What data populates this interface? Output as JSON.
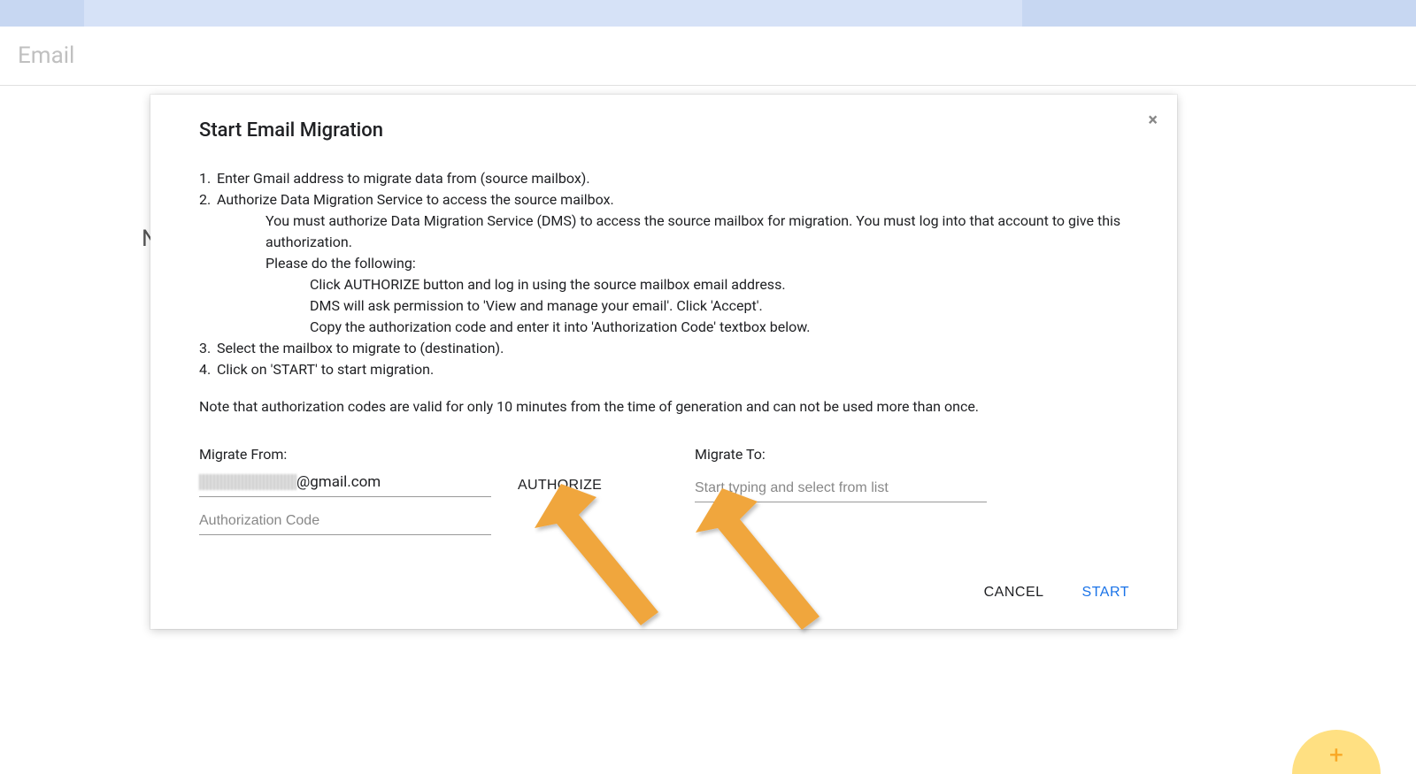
{
  "page": {
    "title": "Email",
    "bg_letter": "N"
  },
  "modal": {
    "title": "Start Email Migration",
    "close_icon": "×",
    "instructions": {
      "step1": "Enter Gmail address to migrate data from (source mailbox).",
      "step2": "Authorize Data Migration Service to access the source mailbox.",
      "step2_sub1": "You must authorize Data Migration Service (DMS) to access the source mailbox for migration. You must log into that account to give this authorization.",
      "step2_sub2": "Please do the following:",
      "step2_sub2_a": "Click AUTHORIZE button and log in using the source mailbox email address.",
      "step2_sub2_b": "DMS will ask permission to 'View and manage your email'. Click 'Accept'.",
      "step2_sub2_c": "Copy the authorization code and enter it into 'Authorization Code' textbox below.",
      "step3": "Select the mailbox to migrate to (destination).",
      "step4": "Click on 'START' to start migration."
    },
    "note": "Note that authorization codes are valid for only 10 minutes from the time of generation and can not be used more than once.",
    "form": {
      "migrate_from_label": "Migrate From:",
      "email_domain": "@gmail.com",
      "authorize_button": "AUTHORIZE",
      "auth_code_placeholder": "Authorization Code",
      "migrate_to_label": "Migrate To:",
      "migrate_to_placeholder": "Start typing and select from list"
    },
    "actions": {
      "cancel": "CANCEL",
      "start": "START"
    }
  },
  "fab": {
    "icon": "+"
  }
}
